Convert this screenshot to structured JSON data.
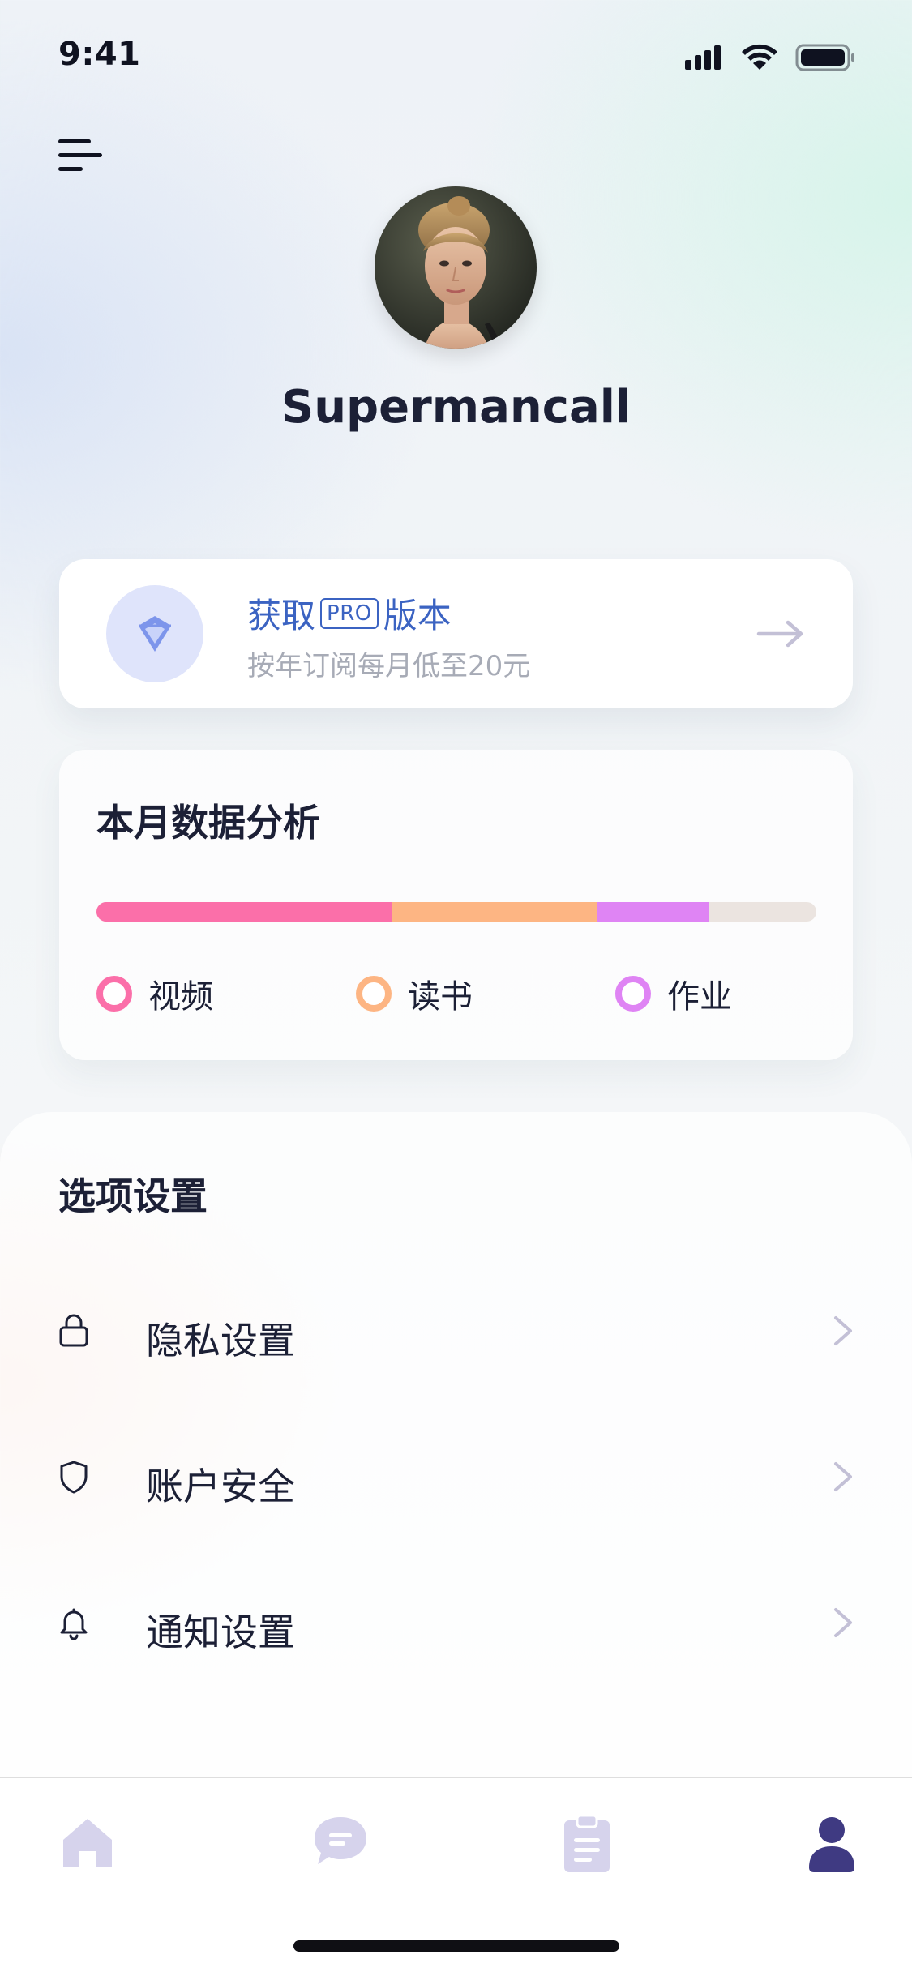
{
  "status_bar": {
    "time": "9:41"
  },
  "profile": {
    "username": "Supermancall"
  },
  "pro_card": {
    "title_prefix": "获取",
    "badge": "PRO",
    "title_suffix": "版本",
    "subtitle": "按年订阅每月低至20元",
    "accent_color": "#3b63c2",
    "icon_name": "diamond-icon",
    "arrow_icon": "arrow-right-icon"
  },
  "stats": {
    "title": "本月数据分析",
    "segments": [
      {
        "label": "视频",
        "fraction": 0.41,
        "color": "#fb6fa9"
      },
      {
        "label": "读书",
        "fraction": 0.285,
        "color": "#fdb583"
      },
      {
        "label": "作业",
        "fraction": 0.155,
        "color": "#df84f4"
      }
    ],
    "track_color": "#ebe4e0"
  },
  "settings": {
    "title": "选项设置",
    "items": [
      {
        "label": "隐私设置",
        "icon": "lock-icon"
      },
      {
        "label": "账户安全",
        "icon": "shield-icon"
      },
      {
        "label": "通知设置",
        "icon": "bell-icon"
      }
    ]
  },
  "tab_bar": {
    "tabs": [
      {
        "icon": "home-icon",
        "active": false
      },
      {
        "icon": "chat-icon",
        "active": false
      },
      {
        "icon": "clipboard-icon",
        "active": false
      },
      {
        "icon": "user-icon",
        "active": true
      }
    ],
    "inactive_color": "#d6d3ec",
    "active_color": "#3f3a82"
  }
}
